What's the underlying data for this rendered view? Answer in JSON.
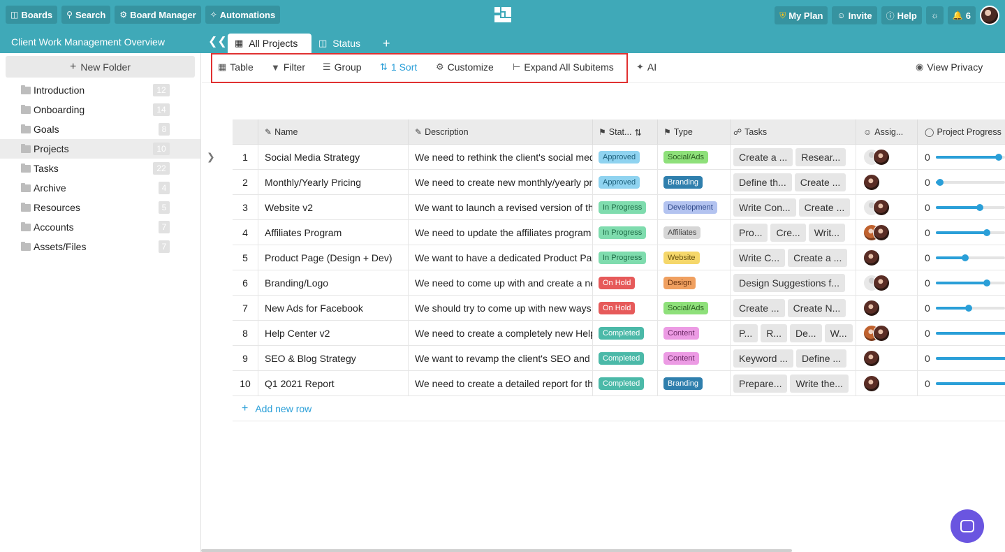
{
  "topbar": {
    "boards": "Boards",
    "search": "Search",
    "board_manager": "Board Manager",
    "automations": "Automations",
    "my_plan": "My Plan",
    "invite": "Invite",
    "help": "Help",
    "notifications_count": "6"
  },
  "board": {
    "title": "Client Work Management Overview",
    "tabs": [
      {
        "label": "All Projects",
        "active": true
      },
      {
        "label": "Status",
        "active": false
      }
    ]
  },
  "sidebar": {
    "new_folder": "New Folder",
    "folders": [
      {
        "name": "Introduction",
        "count": "12"
      },
      {
        "name": "Onboarding",
        "count": "14"
      },
      {
        "name": "Goals",
        "count": "8"
      },
      {
        "name": "Projects",
        "count": "10",
        "active": true
      },
      {
        "name": "Tasks",
        "count": "22"
      },
      {
        "name": "Archive",
        "count": "4"
      },
      {
        "name": "Resources",
        "count": "5"
      },
      {
        "name": "Accounts",
        "count": "7"
      },
      {
        "name": "Assets/Files",
        "count": "7"
      }
    ]
  },
  "toolbar": {
    "table": "Table",
    "filter": "Filter",
    "group": "Group",
    "sort": "1 Sort",
    "customize": "Customize",
    "expand": "Expand All Subitems",
    "ai": "AI",
    "view_privacy": "View Privacy"
  },
  "table": {
    "columns": [
      "Name",
      "Description",
      "Stat...",
      "Type",
      "Tasks",
      "Assig...",
      "Project Progress"
    ],
    "rows": [
      {
        "num": "1",
        "name": "Social Media Strategy",
        "desc": "We need to rethink the client's social media",
        "status": "Approved",
        "type": "Social/Ads",
        "tasks": [
          "Create a ...",
          "Resear..."
        ],
        "avatars": [
          "grey",
          "photo"
        ],
        "progress": "0",
        "progress_fraction": 0.82
      },
      {
        "num": "2",
        "name": "Monthly/Yearly Pricing",
        "desc": "We need to create new monthly/yearly pricing",
        "status": "Approved",
        "type": "Branding",
        "tasks": [
          "Define th...",
          "Create ..."
        ],
        "avatars": [
          "photo"
        ],
        "progress": "0",
        "progress_fraction": 0.05
      },
      {
        "num": "3",
        "name": "Website v2",
        "desc": "We want to launch a revised version of the",
        "status": "In Progress",
        "type": "Development",
        "tasks": [
          "Write Con...",
          "Create ..."
        ],
        "avatars": [
          "grey",
          "photo"
        ],
        "progress": "0",
        "progress_fraction": 0.57
      },
      {
        "num": "4",
        "name": "Affiliates Program",
        "desc": "We need to update the affiliates program",
        "status": "In Progress",
        "type": "Affiliates",
        "tasks": [
          "Pro...",
          "Cre...",
          "Writ..."
        ],
        "avatars": [
          "ginger",
          "photo"
        ],
        "progress": "0",
        "progress_fraction": 0.66
      },
      {
        "num": "5",
        "name": "Product Page (Design + Dev)",
        "desc": "We want to have a dedicated Product Page",
        "status": "In Progress",
        "type": "Website",
        "tasks": [
          "Write C...",
          "Create a ..."
        ],
        "avatars": [
          "photo"
        ],
        "progress": "0",
        "progress_fraction": 0.38
      },
      {
        "num": "6",
        "name": "Branding/Logo",
        "desc": "We need to come up with and create a new",
        "status": "On Hold",
        "type": "Design",
        "tasks": [
          "Design Suggestions f..."
        ],
        "avatars": [
          "grey",
          "photo"
        ],
        "progress": "0",
        "progress_fraction": 0.66
      },
      {
        "num": "7",
        "name": "New Ads for Facebook",
        "desc": "We should try to come up with new ways",
        "status": "On Hold",
        "type": "Social/Ads",
        "tasks": [
          "Create ...",
          "Create N..."
        ],
        "avatars": [
          "photo"
        ],
        "progress": "0",
        "progress_fraction": 0.43
      },
      {
        "num": "8",
        "name": "Help Center v2",
        "desc": "We need to create a completely new Help",
        "status": "Completed",
        "type": "Content",
        "tasks": [
          "P...",
          "R...",
          "De...",
          "W..."
        ],
        "avatars": [
          "ginger",
          "photo"
        ],
        "progress": "0",
        "progress_fraction": 1.0
      },
      {
        "num": "9",
        "name": "SEO & Blog Strategy",
        "desc": "We want to revamp the client's SEO and",
        "status": "Completed",
        "type": "Content",
        "tasks": [
          "Keyword ...",
          "Define ..."
        ],
        "avatars": [
          "photo"
        ],
        "progress": "0",
        "progress_fraction": 1.0
      },
      {
        "num": "10",
        "name": "Q1 2021 Report",
        "desc": "We need to create a detailed report for the",
        "status": "Completed",
        "type": "Branding",
        "tasks": [
          "Prepare...",
          "Write the..."
        ],
        "avatars": [
          "photo"
        ],
        "progress": "0",
        "progress_fraction": 1.0
      }
    ],
    "add_row": "Add new row"
  },
  "colors": {
    "accent": "#3fa9b8",
    "link": "#2a9fd8",
    "status": {
      "Approved": {
        "bg": "#8fd3f0",
        "fg": "#1c5f7a"
      },
      "In Progress": {
        "bg": "#7fdcae",
        "fg": "#1d6b45"
      },
      "On Hold": {
        "bg": "#e65a5a",
        "fg": "#ffffff"
      },
      "Completed": {
        "bg": "#4bb9a8",
        "fg": "#ffffff"
      }
    },
    "type": {
      "Social/Ads": {
        "bg": "#8ee07a",
        "fg": "#2c5e22"
      },
      "Branding": {
        "bg": "#2f7fad",
        "fg": "#ffffff"
      },
      "Development": {
        "bg": "#b3c3f0",
        "fg": "#304a8a"
      },
      "Affiliates": {
        "bg": "#d6d6d6",
        "fg": "#444444"
      },
      "Website": {
        "bg": "#f5d76a",
        "fg": "#6a5310"
      },
      "Design": {
        "bg": "#f0a060",
        "fg": "#6a3410"
      },
      "Content": {
        "bg": "#ec9be4",
        "fg": "#6d2a66"
      }
    }
  },
  "icons": {
    "boards": "boards-icon",
    "search": "search-icon",
    "board_manager": "gear-icon",
    "automations": "automation-icon",
    "plan": "shield-icon",
    "invite": "user-icon",
    "help": "help-icon",
    "theme": "sun-icon",
    "bell": "bell-icon"
  }
}
